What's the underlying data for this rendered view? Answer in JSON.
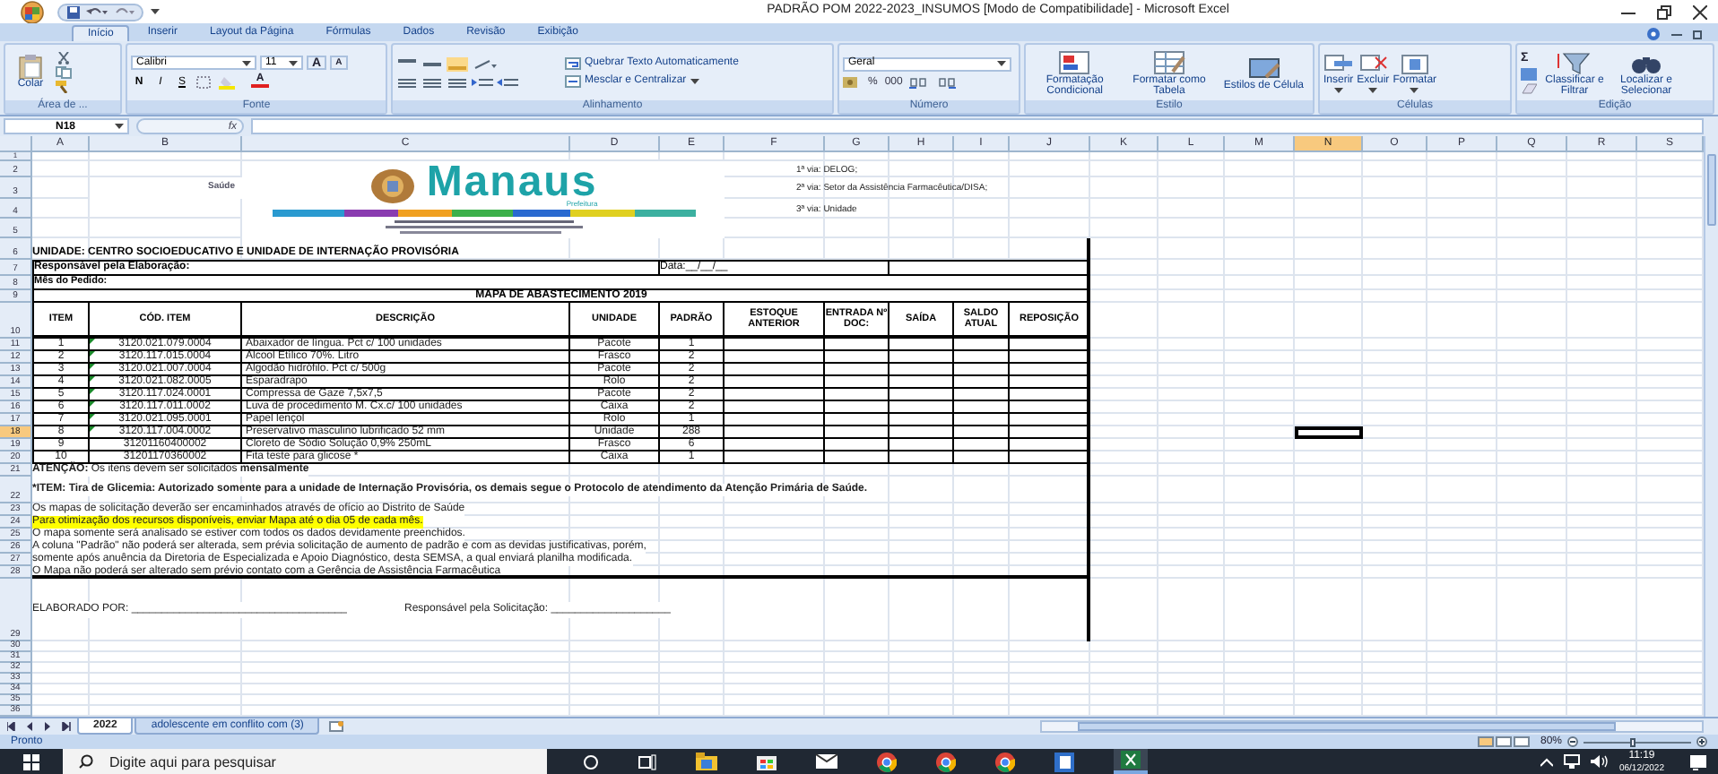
{
  "window": {
    "title": "PADRÃO POM 2022-2023_INSUMOS [Modo de Compatibilidade] - Microsoft Excel"
  },
  "ribbon": {
    "tabs": [
      {
        "label": "Início",
        "selected": true
      },
      {
        "label": "Inserir",
        "selected": false
      },
      {
        "label": "Layout da Página",
        "selected": false
      },
      {
        "label": "Fórmulas",
        "selected": false
      },
      {
        "label": "Dados",
        "selected": false
      },
      {
        "label": "Revisão",
        "selected": false
      },
      {
        "label": "Exibição",
        "selected": false
      }
    ],
    "clipboard": {
      "paste": "Colar",
      "label": "Área de ..."
    },
    "font": {
      "name": "Calibri",
      "size": "11",
      "grow": "A",
      "shrink": "A",
      "bold": "N",
      "italic": "I",
      "underline": "S",
      "font_color_button": "A",
      "label": "Fonte"
    },
    "alignment": {
      "wrap": "Quebrar Texto Automaticamente",
      "merge": "Mesclar e Centralizar",
      "label": "Alinhamento"
    },
    "number": {
      "format": "Geral",
      "percent": "%",
      "thousands": "000",
      "label": "Número"
    },
    "styles": {
      "buttons": [
        "Formatação Condicional",
        "Formatar como Tabela",
        "Estilos de Célula"
      ],
      "label": "Estilo"
    },
    "cells": {
      "buttons": [
        "Inserir",
        "Excluir",
        "Formatar"
      ],
      "label": "Células"
    },
    "editing": {
      "sum": "Σ",
      "buttons": [
        "Classificar e Filtrar",
        "Localizar e Selecionar"
      ],
      "label": "Edição"
    }
  },
  "formula_bar": {
    "name_box": "N18",
    "fx": "fx"
  },
  "sheet": {
    "columns": [
      {
        "label": "A",
        "selected": false
      },
      {
        "label": "B",
        "selected": false
      },
      {
        "label": "C",
        "selected": false
      },
      {
        "label": "D",
        "selected": false
      },
      {
        "label": "E",
        "selected": false
      },
      {
        "label": "F",
        "selected": false
      },
      {
        "label": "G",
        "selected": false
      },
      {
        "label": "H",
        "selected": false
      },
      {
        "label": "I",
        "selected": false
      },
      {
        "label": "J",
        "selected": false
      },
      {
        "label": "K",
        "selected": false
      },
      {
        "label": "L",
        "selected": false
      },
      {
        "label": "M",
        "selected": false
      },
      {
        "label": "N",
        "selected": true
      },
      {
        "label": "O",
        "selected": false
      },
      {
        "label": "P",
        "selected": false
      },
      {
        "label": "Q",
        "selected": false
      },
      {
        "label": "R",
        "selected": false
      },
      {
        "label": "S",
        "selected": false
      }
    ],
    "rows": [
      {
        "label": "1",
        "selected": false
      },
      {
        "label": "2",
        "selected": false
      },
      {
        "label": "3",
        "selected": false
      },
      {
        "label": "4",
        "selected": false
      },
      {
        "label": "5",
        "selected": false
      },
      {
        "label": "6",
        "selected": false
      },
      {
        "label": "7",
        "selected": false
      },
      {
        "label": "8",
        "selected": false
      },
      {
        "label": "9",
        "selected": false
      },
      {
        "label": "10",
        "selected": false
      },
      {
        "label": "11",
        "selected": false
      },
      {
        "label": "12",
        "selected": false
      },
      {
        "label": "13",
        "selected": false
      },
      {
        "label": "14",
        "selected": false
      },
      {
        "label": "15",
        "selected": false
      },
      {
        "label": "16",
        "selected": false
      },
      {
        "label": "17",
        "selected": false
      },
      {
        "label": "18",
        "selected": true
      },
      {
        "label": "19",
        "selected": false
      },
      {
        "label": "20",
        "selected": false
      },
      {
        "label": "21",
        "selected": false
      },
      {
        "label": "22",
        "selected": false
      },
      {
        "label": "23",
        "selected": false
      },
      {
        "label": "24",
        "selected": false
      },
      {
        "label": "25",
        "selected": false
      },
      {
        "label": "26",
        "selected": false
      },
      {
        "label": "27",
        "selected": false
      },
      {
        "label": "28",
        "selected": false
      },
      {
        "label": "29",
        "selected": false
      },
      {
        "label": "30",
        "selected": false
      },
      {
        "label": "31",
        "selected": false
      },
      {
        "label": "32",
        "selected": false
      },
      {
        "label": "33",
        "selected": false
      },
      {
        "label": "34",
        "selected": false
      },
      {
        "label": "35",
        "selected": false
      },
      {
        "label": "36",
        "selected": false
      }
    ]
  },
  "document": {
    "logo": {
      "department": "Saúde",
      "city": "Manaus",
      "subtitle": "Prefeitura"
    },
    "vias": [
      "1ª via: DELOG;",
      "2ª via: Setor da Assistência Farmacêutica/DISA;",
      "3ª via: Unidade"
    ],
    "unidade": "UNIDADE: CENTRO SOCIOEDUCATIVO E UNIDADE DE INTERNAÇÃO PROVISÓRIA",
    "responsavel": "Responsável pela Elaboração:",
    "data": "Data:__/__/__",
    "mes": "Mês do Pedido:",
    "table_title": "MAPA DE ABASTECIMENTO 2019",
    "columns": [
      "ITEM",
      "CÓD. ITEM",
      "DESCRIÇÃO",
      "UNIDADE",
      "PADRÃO",
      "ESTOQUE ANTERIOR",
      "ENTRADA Nº DOC:",
      "SAÍDA",
      "SALDO ATUAL",
      "REPOSIÇÃO"
    ],
    "rows": [
      {
        "item": "1",
        "code": "3120.021.079.0004",
        "flagged": true,
        "description": "Abaixador de língua. Pct c/ 100 unidades",
        "unit": "Pacote",
        "standard": "1"
      },
      {
        "item": "2",
        "code": "3120.117.015.0004",
        "flagged": true,
        "description": "Álcool Etílico 70%. Litro",
        "unit": "Frasco",
        "standard": "2"
      },
      {
        "item": "3",
        "code": "3120.021.007.0004",
        "flagged": true,
        "description": "Algodão hidrófilo. Pct c/ 500g",
        "unit": "Pacote",
        "standard": "2"
      },
      {
        "item": "4",
        "code": "3120.021.082.0005",
        "flagged": true,
        "description": "Esparadrapo",
        "unit": "Rolo",
        "standard": "2"
      },
      {
        "item": "5",
        "code": "3120.117.024.0001",
        "flagged": true,
        "description": "Compressa de Gaze 7,5x7,5",
        "unit": "Pacote",
        "standard": "2"
      },
      {
        "item": "6",
        "code": "3120.117.011.0002",
        "flagged": true,
        "description": "Luva de procedimento M. Cx.c/ 100 unidades",
        "unit": "Caixa",
        "standard": "2"
      },
      {
        "item": "7",
        "code": "3120.021.095.0001",
        "flagged": true,
        "description": "Papel lençol",
        "unit": "Rolo",
        "standard": "1"
      },
      {
        "item": "8",
        "code": "3120.117.004.0002",
        "flagged": true,
        "description": "Preservativo masculino lubrificado 52 mm",
        "unit": "Unidade",
        "standard": "288"
      },
      {
        "item": "9",
        "code": "31201160400002",
        "flagged": false,
        "description": "Cloreto de Sódio Solução 0,9% 250mL",
        "unit": "Frasco",
        "standard": "6"
      },
      {
        "item": "10",
        "code": "31201170360002",
        "flagged": false,
        "description": "Fita teste para glicose *",
        "unit": "Caixa",
        "standard": "1"
      }
    ],
    "notes": [
      {
        "text": "**ATENÇÃO:** Os itens devem ser solicitados **mensalmente**",
        "bold": false,
        "highlighted": false
      },
      {
        "text": "*ITEM: Tira de Glicemia: Autorizado somente para a unidade de Internação Provisória, os demais segue o Protocolo de atendimento da Atenção Primária de Saúde.",
        "bold": true,
        "highlighted": false
      },
      {
        "text": "Os mapas de solicitação deverão ser encaminhados através de ofício ao Distrito de Saúde",
        "bold": false,
        "highlighted": false
      },
      {
        "text": "Para otimização dos recursos disponíveis, enviar Mapa até o dia 05 de cada mês.",
        "bold": false,
        "highlighted": true
      },
      {
        "text": "O mapa somente será analisado se estiver com todos os dados devidamente preenchidos.",
        "bold": false,
        "highlighted": false
      },
      {
        "text": "A coluna \"Padrão\" não poderá ser alterada, sem prévia solicitação de aumento de padrão e com as devidas justificativas, porém,",
        "bold": false,
        "highlighted": false
      },
      {
        "text": "somente após anuência da Diretoria de Especializada e Apoio Diagnóstico, desta SEMSA, a qual enviará planilha modificada.",
        "bold": false,
        "highlighted": false
      },
      {
        "text": "O Mapa não poderá ser alterado sem prévio contato com a Gerência de Assistência Farmacêutica",
        "bold": false,
        "highlighted": false
      }
    ],
    "signatures": [
      "ELABORADO POR: ____________________________________",
      "Responsável pela Solicitação: ____________________"
    ]
  },
  "sheet_tabs": [
    {
      "label": "2022",
      "selected": true
    },
    {
      "label": "adolescente em conflito com (3)",
      "selected": false
    }
  ],
  "status_bar": {
    "status": "Pronto",
    "zoom": "80%",
    "zoom_slider": {
      "level": 0.45
    }
  },
  "taskbar": {
    "search_placeholder": "Digite aqui para pesquisar",
    "time": "11:19",
    "date": "06/12/2022"
  }
}
